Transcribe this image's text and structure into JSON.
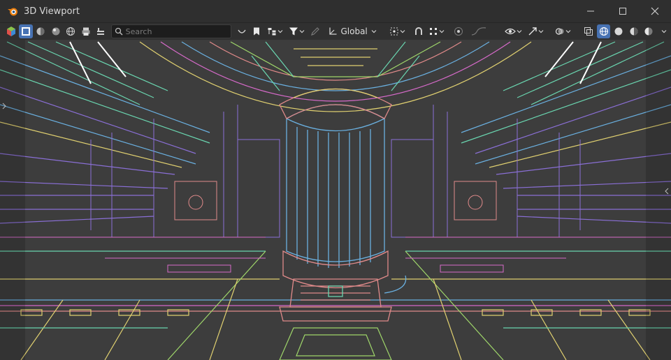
{
  "window": {
    "title": "3D Viewport",
    "logo_icon": "blender-logo-icon"
  },
  "window_controls": [
    "minimize-icon",
    "maximize-icon",
    "close-icon"
  ],
  "header": {
    "search_placeholder": "Search",
    "transform_orientation": "Global",
    "accent": "#4772b3"
  },
  "viewport": {
    "display_mode": "wireframe",
    "background": "#3d3d3d",
    "wire_colors": [
      "#d66ac9",
      "#8a6fd6",
      "#6ad6b0",
      "#e0d070",
      "#6ab0e0",
      "#e08a8a",
      "#9fd66a"
    ]
  }
}
